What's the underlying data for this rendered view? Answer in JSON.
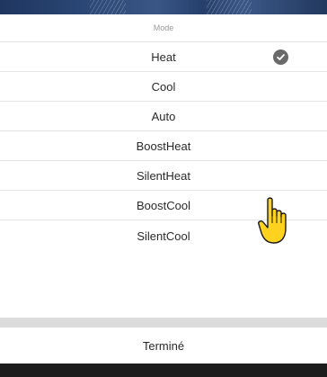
{
  "picker": {
    "header": "Mode",
    "selected": "Heat",
    "options": [
      {
        "label": "Heat"
      },
      {
        "label": "Cool"
      },
      {
        "label": "Auto"
      },
      {
        "label": "BoostHeat"
      },
      {
        "label": "SilentHeat"
      },
      {
        "label": "BoostCool"
      },
      {
        "label": "SilentCool"
      }
    ],
    "done_label": "Terminé"
  },
  "icons": {
    "checkmark": "checkmark-circle-icon",
    "pointer": "pointing-hand-icon"
  },
  "colors": {
    "top_band": "#2d4a78",
    "check_circle": "#6a6a6a",
    "separator": "#dcdcdc",
    "hand_fill": "#ffd21f"
  }
}
